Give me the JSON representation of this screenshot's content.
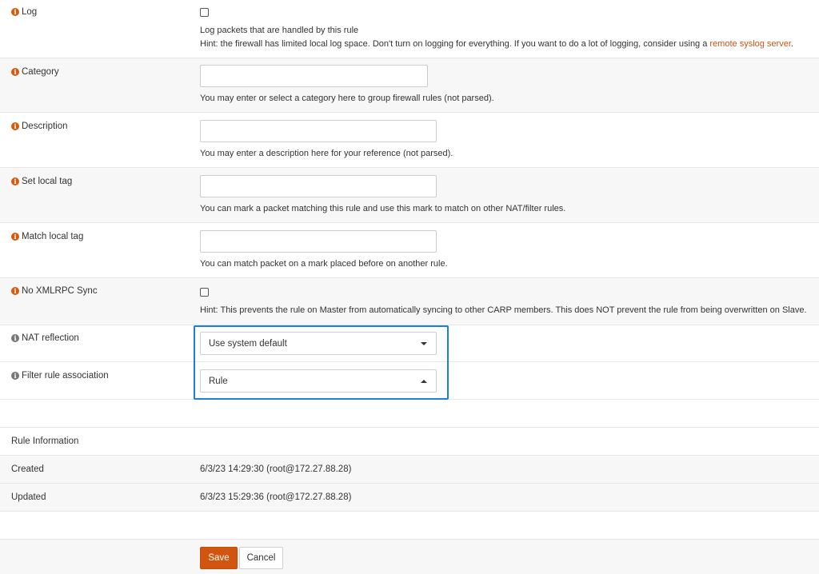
{
  "log": {
    "label": "Log",
    "checkbox_text": "Log packets that are handled by this rule",
    "hint_prefix": "Hint: the firewall has limited local log space. Don't turn on logging for everything. If you want to do a lot of logging, consider using a ",
    "hint_link": "remote syslog server",
    "hint_suffix": "."
  },
  "category": {
    "label": "Category",
    "value": "",
    "hint": "You may enter or select a category here to group firewall rules (not parsed)."
  },
  "description": {
    "label": "Description",
    "value": "",
    "hint": "You may enter a description here for your reference (not parsed)."
  },
  "set_local_tag": {
    "label": "Set local tag",
    "value": "",
    "hint": "You can mark a packet matching this rule and use this mark to match on other NAT/filter rules."
  },
  "match_local_tag": {
    "label": "Match local tag",
    "value": "",
    "hint": "You can match packet on a mark placed before on another rule."
  },
  "no_xmlrpc_sync": {
    "label": "No XMLRPC Sync",
    "hint": "Hint: This prevents the rule on Master from automatically syncing to other CARP members. This does NOT prevent the rule from being overwritten on Slave."
  },
  "nat_reflection": {
    "label": "NAT reflection",
    "selected": "Use system default"
  },
  "filter_rule_association": {
    "label": "Filter rule association",
    "selected": "Rule"
  },
  "rule_information": {
    "heading": "Rule Information",
    "created_label": "Created",
    "created_value": "6/3/23 14:29:30 (root@172.27.88.28)",
    "updated_label": "Updated",
    "updated_value": "6/3/23 15:29:36 (root@172.27.88.28)"
  },
  "actions": {
    "save": "Save",
    "cancel": "Cancel"
  },
  "colors": {
    "accent": "#d1550f",
    "highlight": "#1e7fd6",
    "info_icon": "#d15c10"
  }
}
